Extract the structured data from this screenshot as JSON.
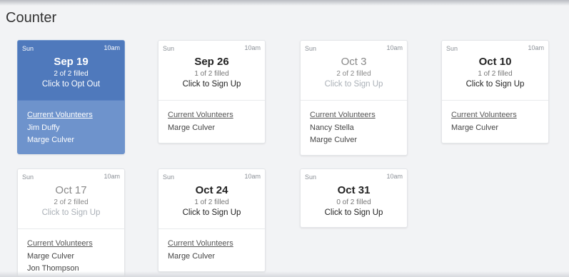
{
  "section": {
    "title": "Counter"
  },
  "volunteer_heading": "Current Volunteers",
  "colors": {
    "selected_header": "#4f79bc",
    "selected_body": "#6e93cc",
    "page_bg": "#f2f3f5"
  },
  "slots": [
    {
      "day": "Sun",
      "time": "10am",
      "date": "Sep 19",
      "filled": "2 of 2 filled",
      "action": "Click to Opt Out",
      "state": "selected",
      "volunteers": [
        "Jim Duffy",
        "Marge Culver"
      ]
    },
    {
      "day": "Sun",
      "time": "10am",
      "date": "Sep 26",
      "filled": "1 of 2 filled",
      "action": "Click to Sign Up",
      "state": "open",
      "volunteers": [
        "Marge Culver"
      ]
    },
    {
      "day": "Sun",
      "time": "10am",
      "date": "Oct 3",
      "filled": "2 of 2 filled",
      "action": "Click to Sign Up",
      "state": "full",
      "volunteers": [
        "Nancy Stella",
        "Marge Culver"
      ]
    },
    {
      "day": "Sun",
      "time": "10am",
      "date": "Oct 10",
      "filled": "1 of 2 filled",
      "action": "Click to Sign Up",
      "state": "open",
      "volunteers": [
        "Marge Culver"
      ]
    },
    {
      "day": "Sun",
      "time": "10am",
      "date": "Oct 17",
      "filled": "2 of 2 filled",
      "action": "Click to Sign Up",
      "state": "full",
      "volunteers": [
        "Marge Culver",
        "Jon Thompson"
      ]
    },
    {
      "day": "Sun",
      "time": "10am",
      "date": "Oct 24",
      "filled": "1 of 2 filled",
      "action": "Click to Sign Up",
      "state": "open",
      "volunteers": [
        "Marge Culver"
      ]
    },
    {
      "day": "Sun",
      "time": "10am",
      "date": "Oct 31",
      "filled": "0 of 2 filled",
      "action": "Click to Sign Up",
      "state": "open",
      "volunteers": []
    }
  ]
}
